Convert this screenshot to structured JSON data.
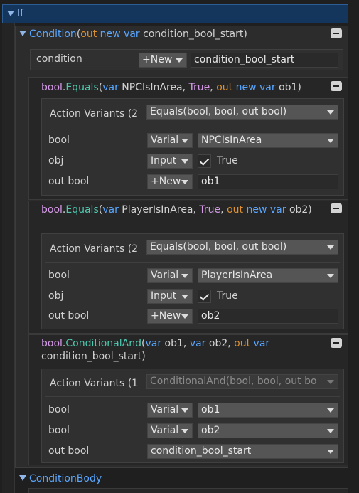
{
  "if_label": "If",
  "condition_header": {
    "title": "Condition",
    "out_kw": "out",
    "new_kw": "new",
    "var_kw": "var",
    "name": "condition_bool_start"
  },
  "condition_row": {
    "label": "condition",
    "new_button": "+New",
    "value": "condition_bool_start"
  },
  "actions": [
    {
      "head": {
        "type": "bool",
        "method": "Equals",
        "p1_kw": "var",
        "p1": "NPCIsInArea",
        "p2": "True",
        "p3_out": "out",
        "p3_new": "new",
        "p3_var": "var",
        "p3": "ob1"
      },
      "variants_label": "Action Variants (2",
      "variant_selected": "Equals(bool, bool, out bool)",
      "rows": [
        {
          "label": "bool",
          "mode": "Varial",
          "value": "NPCIsInArea"
        },
        {
          "label": "obj",
          "mode": "Input",
          "value": "True"
        },
        {
          "label": "out bool",
          "mode": "+New",
          "value": "ob1"
        }
      ]
    },
    {
      "head": {
        "type": "bool",
        "method": "Equals",
        "p1_kw": "var",
        "p1": "PlayerIsInArea",
        "p2": "True",
        "p3_out": "out",
        "p3_new": "new",
        "p3_var": "var",
        "p3": "ob2"
      },
      "variants_label": "Action Variants (2",
      "variant_selected": "Equals(bool, bool, out bool)",
      "rows": [
        {
          "label": "bool",
          "mode": "Varial",
          "value": "PlayerIsInArea"
        },
        {
          "label": "obj",
          "mode": "Input",
          "value": "True"
        },
        {
          "label": "out bool",
          "mode": "+New",
          "value": "ob2"
        }
      ]
    },
    {
      "head": {
        "type": "bool",
        "method": "ConditionalAnd",
        "p1_kw": "var",
        "p1": "ob1",
        "p2_kw": "var",
        "p2": "ob2",
        "p3_out": "out",
        "p3_var": "var",
        "p3": "condition_bool_start"
      },
      "variants_label": "Action Variants (1",
      "variant_selected": "ConditionalAnd(bool, bool, out bo",
      "rows": [
        {
          "label": "bool",
          "mode": "Varial",
          "value": "ob1"
        },
        {
          "label": "bool",
          "mode": "Varial",
          "value": "ob2"
        },
        {
          "label": "out bool",
          "value": "condition_bool_start"
        }
      ]
    }
  ],
  "condition_body_label": "ConditionBody"
}
